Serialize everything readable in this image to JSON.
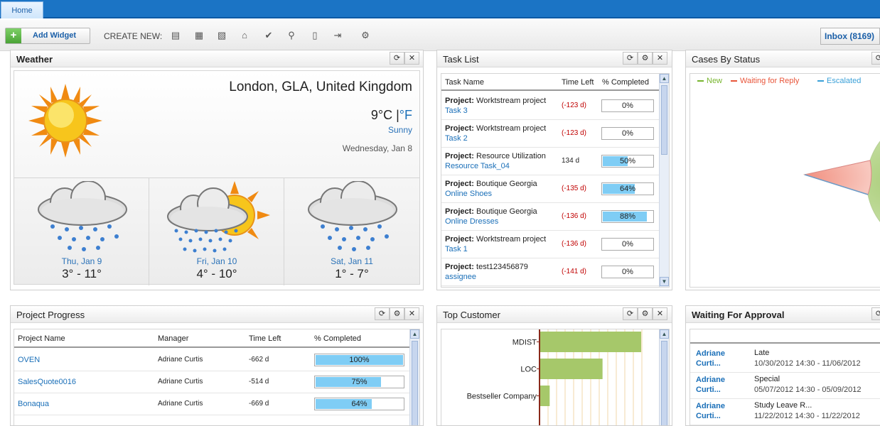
{
  "topnav": {
    "home_tab": "Home"
  },
  "toolbar": {
    "add_widget": "Add Widget",
    "create_new_label": "CREATE NEW:",
    "inbox": "Inbox (8169)",
    "create_icons": [
      "table-icon",
      "calendar-icon",
      "documents-icon",
      "house-icon",
      "check-icon",
      "person-file-icon",
      "document-icon",
      "export-icon",
      "settings-doc-icon"
    ]
  },
  "weather": {
    "title": "Weather",
    "location": "London, GLA, United Kingdom",
    "temp": "9°C",
    "unit_sep": " |",
    "unit_alt": "°F",
    "condition": "Sunny",
    "date": "Wednesday, Jan 8",
    "forecast": [
      {
        "day": "Thu, Jan 9",
        "range": "3° - 11°"
      },
      {
        "day": "Fri, Jan 10",
        "range": "4° - 10°"
      },
      {
        "day": "Sat, Jan 11",
        "range": "1° - 7°"
      }
    ]
  },
  "tasklist": {
    "title": "Task List",
    "headers": [
      "Task Name",
      "Time Left",
      "% Completed"
    ],
    "project_label": "Project:",
    "rows": [
      {
        "project": "Worktstream project",
        "task": "Task 3",
        "time": "(-123 d)",
        "pct": "0%",
        "value": 0,
        "overdue": true
      },
      {
        "project": "Worktstream project",
        "task": "Task 2",
        "time": "(-123 d)",
        "pct": "0%",
        "value": 0,
        "overdue": true
      },
      {
        "project": "Resource Utilization",
        "task": "Resource Task_04",
        "time": "134 d",
        "pct": "50%",
        "value": 50,
        "overdue": false
      },
      {
        "project": "Boutique Georgia",
        "task": "Online Shoes",
        "time": "(-135 d)",
        "pct": "64%",
        "value": 64,
        "overdue": true
      },
      {
        "project": "Boutique Georgia",
        "task": "Online Dresses",
        "time": "(-136 d)",
        "pct": "88%",
        "value": 88,
        "overdue": true
      },
      {
        "project": "Worktstream project",
        "task": "Task 1",
        "time": "(-136 d)",
        "pct": "0%",
        "value": 0,
        "overdue": true
      },
      {
        "project": "test123456879",
        "task": "assignee",
        "time": "(-141 d)",
        "pct": "0%",
        "value": 0,
        "overdue": true
      }
    ]
  },
  "cases": {
    "title": "Cases By Status",
    "legend": [
      {
        "name": "New",
        "color": "#77b52e"
      },
      {
        "name": "Waiting for Reply",
        "color": "#e8553a"
      },
      {
        "name": "Escalated",
        "color": "#3aa0d8"
      }
    ]
  },
  "projectprogress": {
    "title": "Project Progress",
    "headers": [
      "Project Name",
      "Manager",
      "Time Left",
      "% Completed"
    ],
    "rows": [
      {
        "name": "OVEN",
        "manager": "Adriane Curtis",
        "time": "-662 d",
        "pct": "100%",
        "value": 100
      },
      {
        "name": "SalesQuote0016",
        "manager": "Adriane Curtis",
        "time": "-514 d",
        "pct": "75%",
        "value": 75
      },
      {
        "name": "Bonaqua",
        "manager": "Adriane Curtis",
        "time": "-669 d",
        "pct": "64%",
        "value": 64
      }
    ]
  },
  "topcustomer": {
    "title": "Top Customer",
    "chart_data": {
      "type": "bar",
      "categories": [
        "MDIST",
        "LOC",
        "Bestseller Company"
      ],
      "values": [
        100,
        62,
        10
      ],
      "orientation": "horizontal",
      "grid": true
    }
  },
  "approval": {
    "title": "Waiting For Approval",
    "rows": [
      {
        "name": "Adriane",
        "name2": "Curti...",
        "type": "Late",
        "range": "10/30/2012 14:30 - 11/06/2012"
      },
      {
        "name": "Adriane",
        "name2": "Curti...",
        "type": "Special",
        "range": "05/07/2012 14:30 - 05/09/2012"
      },
      {
        "name": "Adriane",
        "name2": "Curti...",
        "type": "Study Leave R...",
        "range": "11/22/2012 14:30 - 11/22/2012"
      }
    ]
  }
}
